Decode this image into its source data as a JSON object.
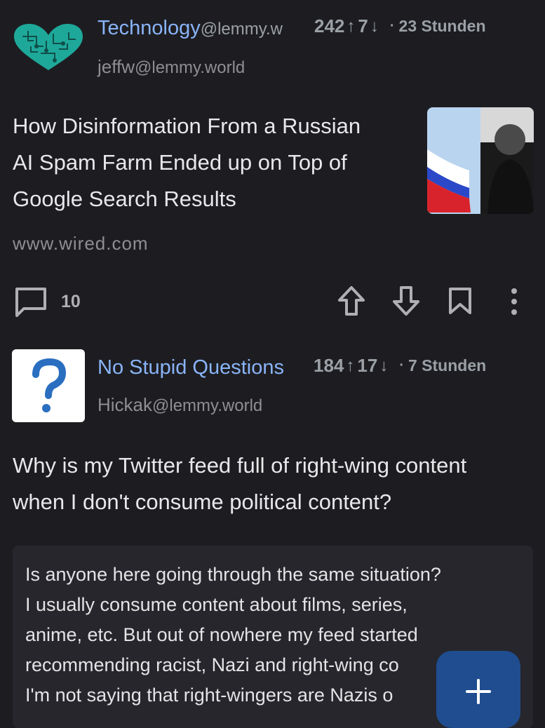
{
  "posts": [
    {
      "community": "Technology",
      "community_instance": "@lemmy.w",
      "author": "jeffw",
      "author_instance": "@lemmy.world",
      "upvotes": "242",
      "downvotes": "7",
      "time": "23 Stunden",
      "title_lines": [
        "How Disinformation From a Russian",
        "AI Spam Farm Ended up on Top of",
        "Google Search Results"
      ],
      "domain": "www.wired.com",
      "comments": "10",
      "community_icon": "circuit-heart-icon"
    },
    {
      "community": "No Stupid Questions",
      "author": "Hickak",
      "author_instance": "@lemmy.world",
      "upvotes": "184",
      "downvotes": "17",
      "time": "7 Stunden",
      "title_lines": [
        "Why is my Twitter feed full of right-wing content",
        "when I don't consume political content?"
      ],
      "body_lines": [
        "Is anyone here going through the same situation?",
        "I usually consume content about films, series,",
        "anime, etc. But out of nowhere my feed started",
        "recommending racist, Nazi and right-wing co",
        "I'm not saying that right-wingers are Nazis o"
      ],
      "community_icon": "question-mark-icon"
    }
  ],
  "fab": {
    "icon": "plus-icon"
  },
  "colors": {
    "background": "#1d1d21",
    "accent": "#8ab4f8",
    "fab": "#1f4d90"
  }
}
